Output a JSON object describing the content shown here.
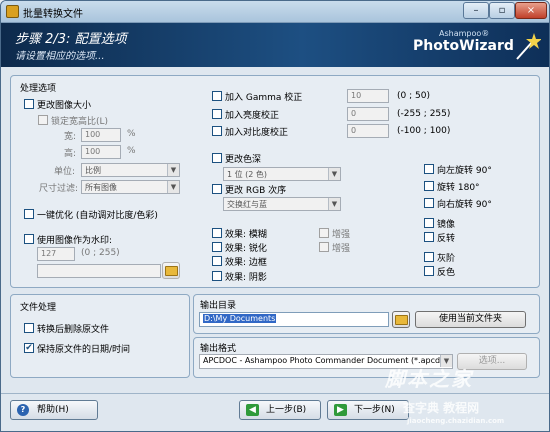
{
  "window": {
    "title": "批量转换文件",
    "minimize_glyph": "–",
    "restore_glyph": "▫",
    "close_glyph": "×"
  },
  "header": {
    "step": "步骤 2/3: 配置选项",
    "subtitle": "请设置相应的选项...",
    "brand_small": "Ashampoo®",
    "brand": "PhotoWizard"
  },
  "options": {
    "title": "处理选项",
    "resize": {
      "label": "更改图像大小",
      "keep_ratio": "锁定宽高比(L)",
      "width_label": "宽:",
      "width_value": "100",
      "height_label": "高:",
      "height_value": "100",
      "unit_symbol": "%",
      "unit_label": "单位:",
      "unit_value": "比例",
      "filter_label": "尺寸过滤:",
      "filter_value": "所有图像"
    },
    "auto_optimize": "一键优化 (自动调对比度/色彩)",
    "watermark": {
      "label": "使用图像作为水印:",
      "value": "127",
      "range": "(0 ; 255)"
    },
    "gamma": {
      "label": "加入 Gamma 校正",
      "value": "10",
      "range": "(0 ; 50)"
    },
    "brightness": {
      "label": "加入亮度校正",
      "value": "0",
      "range": "(-255 ; 255)"
    },
    "contrast": {
      "label": "加入对比度校正",
      "value": "0",
      "range": "(-100 ; 100)"
    },
    "color_depth": {
      "label": "更改色深",
      "value": "1 位 (2 色)"
    },
    "rgb_order": {
      "label": "更改 RGB 次序",
      "value": "交换红与蓝"
    },
    "effects": [
      {
        "label": "效果: 模糊",
        "extra": "增强"
      },
      {
        "label": "效果: 锐化",
        "extra": "增强"
      },
      {
        "label": "效果: 边框"
      },
      {
        "label": "效果: 阴影"
      }
    ],
    "rotate": [
      "向左旋转 90°",
      "旋转 180°",
      "向右旋转 90°"
    ],
    "mirror": [
      "镜像",
      "反转"
    ],
    "color_mode": [
      "灰阶",
      "反色"
    ]
  },
  "file_handling": {
    "title": "文件处理",
    "delete_original": "转换后删除原文件",
    "keep_date": "保持原文件的日期/时间",
    "keep_date_checked": "✔"
  },
  "output_dir": {
    "title": "输出目录",
    "value": "D:\\My Documents",
    "use_current": "使用当前文件夹"
  },
  "output_format": {
    "title": "输出格式",
    "value": "APCDOC - Ashampoo Photo Commander Document (*.apcdoc)",
    "options_button": "选项..."
  },
  "buttons": {
    "help": "帮助(H)",
    "back": "上一步(B)",
    "next": "下一步(N)"
  },
  "watermark_overlay": {
    "line1": "脚本之家",
    "line2": "查字典 教程网",
    "line3": "jiaocheng.chazidian.com"
  },
  "colors": {
    "header_dark": "#0d2a4c",
    "accent": "#1d4f82",
    "selection": "#3168c6"
  }
}
